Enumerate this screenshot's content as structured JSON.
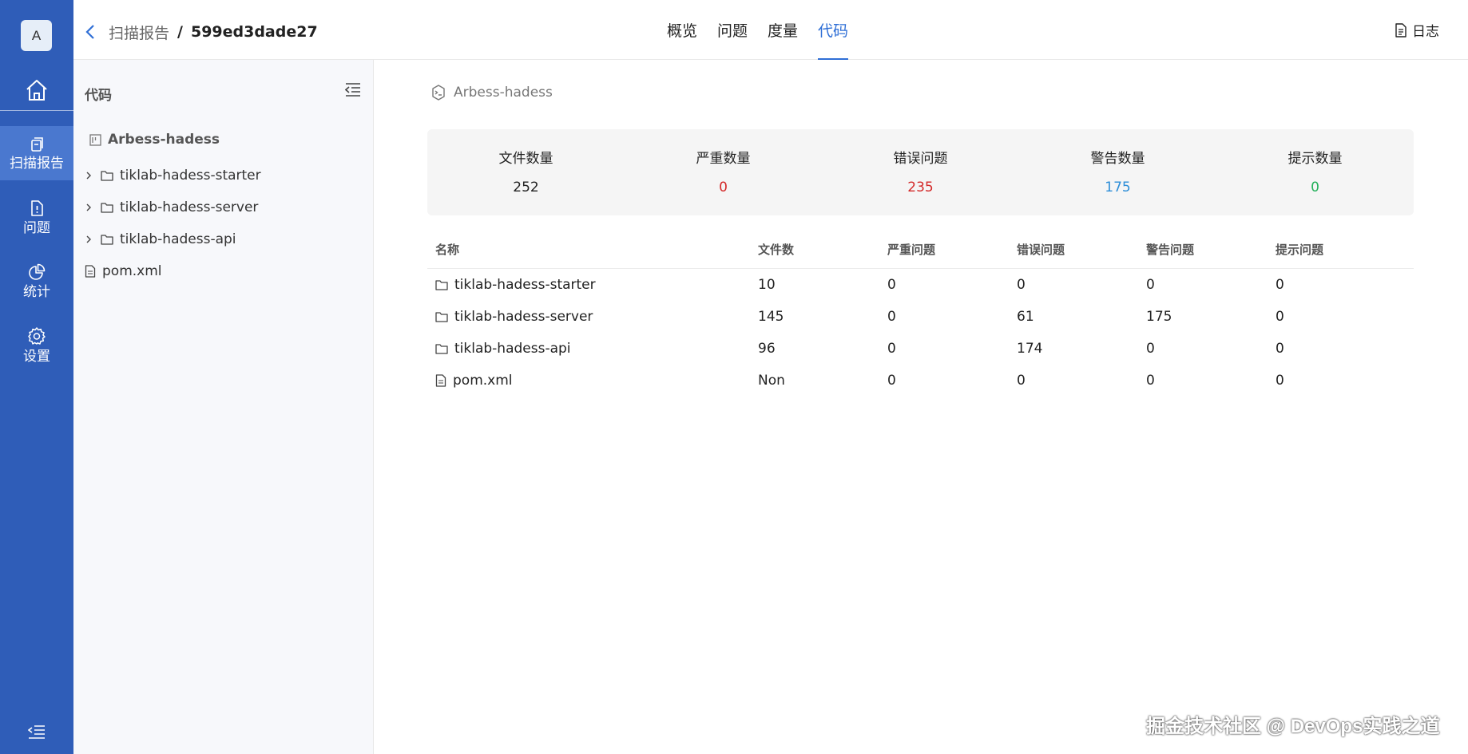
{
  "nav": {
    "avatar": "A",
    "items": [
      {
        "label": "扫描报告",
        "active": true
      },
      {
        "label": "问题",
        "active": false
      },
      {
        "label": "统计",
        "active": false
      },
      {
        "label": "设置",
        "active": false
      }
    ]
  },
  "header": {
    "parent": "扫描报告",
    "separator": "/",
    "current": "599ed3dade27",
    "tabs": [
      "概览",
      "问题",
      "度量",
      "代码"
    ],
    "active_tab": "代码",
    "log_label": "日志"
  },
  "tree": {
    "title": "代码",
    "root": "Arbess-hadess",
    "items": [
      {
        "type": "folder",
        "label": "tiklab-hadess-starter"
      },
      {
        "type": "folder",
        "label": "tiklab-hadess-server"
      },
      {
        "type": "folder",
        "label": "tiklab-hadess-api"
      },
      {
        "type": "file",
        "label": "pom.xml"
      }
    ]
  },
  "main": {
    "repo": "Arbess-hadess",
    "stats": [
      {
        "label": "文件数量",
        "value": "252",
        "color": "#222222"
      },
      {
        "label": "严重数量",
        "value": "0",
        "color": "#d42a2a"
      },
      {
        "label": "错误问题",
        "value": "235",
        "color": "#d42a2a"
      },
      {
        "label": "警告数量",
        "value": "175",
        "color": "#2e8ed8"
      },
      {
        "label": "提示数量",
        "value": "0",
        "color": "#23b05a"
      }
    ],
    "table": {
      "headers": [
        "名称",
        "文件数",
        "严重问题",
        "错误问题",
        "警告问题",
        "提示问题"
      ],
      "rows": [
        {
          "type": "folder",
          "name": "tiklab-hadess-starter",
          "files": "10",
          "critical": "0",
          "error": "0",
          "warning": "0",
          "hint": "0"
        },
        {
          "type": "folder",
          "name": "tiklab-hadess-server",
          "files": "145",
          "critical": "0",
          "error": "61",
          "warning": "175",
          "hint": "0"
        },
        {
          "type": "folder",
          "name": "tiklab-hadess-api",
          "files": "96",
          "critical": "0",
          "error": "174",
          "warning": "0",
          "hint": "0"
        },
        {
          "type": "file",
          "name": "pom.xml",
          "files": "Non",
          "critical": "0",
          "error": "0",
          "warning": "0",
          "hint": "0"
        }
      ]
    }
  },
  "watermark": "掘金技术社区 @ DevOps实践之道"
}
